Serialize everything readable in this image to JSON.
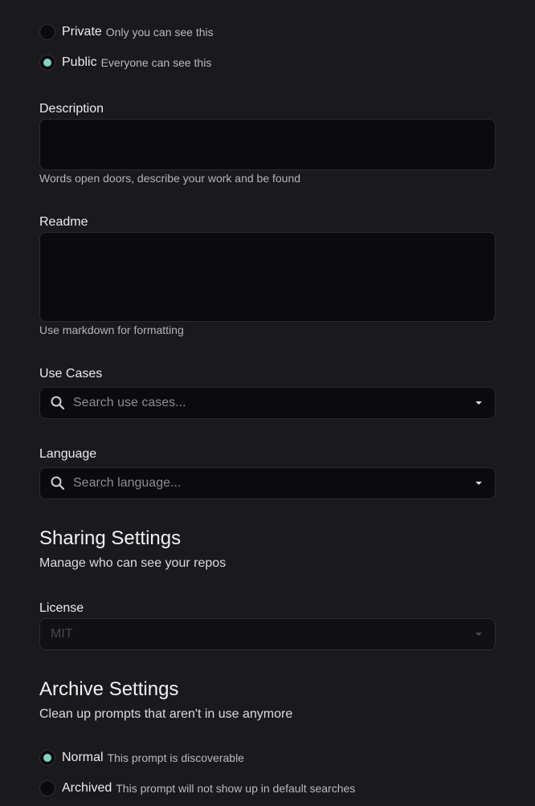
{
  "visibility": {
    "options": [
      {
        "label": "Private",
        "description": "Only you can see this",
        "checked": false
      },
      {
        "label": "Public",
        "description": "Everyone can see this",
        "checked": true
      }
    ]
  },
  "description": {
    "label": "Description",
    "value": "",
    "helper": "Words open doors, describe your work and be found"
  },
  "readme": {
    "label": "Readme",
    "value": "",
    "helper": "Use markdown for formatting"
  },
  "use_cases": {
    "label": "Use Cases",
    "placeholder": "Search use cases..."
  },
  "language": {
    "label": "Language",
    "placeholder": "Search language..."
  },
  "sharing": {
    "title": "Sharing Settings",
    "subtitle": "Manage who can see your repos",
    "license_label": "License",
    "license_value": "MIT"
  },
  "archive": {
    "title": "Archive Settings",
    "subtitle": "Clean up prompts that aren't in use anymore",
    "options": [
      {
        "label": "Normal",
        "description": "This prompt is discoverable",
        "checked": true
      },
      {
        "label": "Archived",
        "description": "This prompt will not show up in default searches",
        "checked": false
      }
    ]
  },
  "colors": {
    "background": "#1a1a1d",
    "input_background": "#0b0b0e",
    "accent": "#7fd3c6"
  },
  "icons": {
    "search": "search-icon",
    "dropdown": "chevron-down-icon"
  }
}
